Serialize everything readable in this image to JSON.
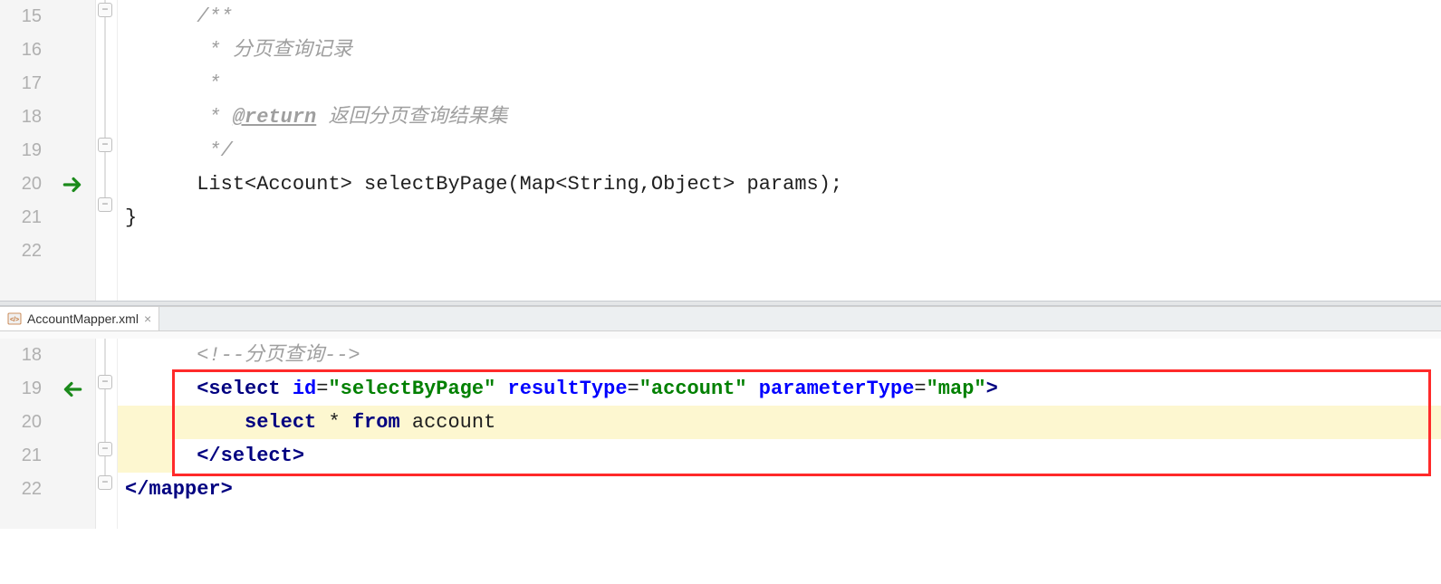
{
  "pane1": {
    "lines": [
      "15",
      "16",
      "17",
      "18",
      "19",
      "20",
      "21",
      "22"
    ],
    "comment_open": "/**",
    "comment_l1": " * 分页查询记录",
    "comment_l2": " *",
    "comment_return_tag": "@return",
    "comment_return_text": " 返回分页查询结果集",
    "comment_close": " */",
    "method_sig": "List<Account> selectByPage(Map<String,Object> params);",
    "brace_close": "}"
  },
  "tab": {
    "filename": "AccountMapper.xml",
    "close_glyph": "×"
  },
  "pane2": {
    "lines": [
      "18",
      "19",
      "20",
      "21",
      "22"
    ],
    "xml_comment": "<!--分页查询-->",
    "tag_open_lt": "<",
    "tag_select": "select",
    "attr_id": "id",
    "val_id": "\"selectByPage\"",
    "attr_rt": "resultType",
    "val_rt": "\"account\"",
    "attr_pt": "parameterType",
    "val_pt": "\"map\"",
    "tag_open_gt": ">",
    "sql_select": "select",
    "sql_star": " * ",
    "sql_from": "from",
    "sql_table": " account",
    "tag_close_select": "</",
    "tag_close_select_name": "select",
    "tag_close_gt": ">",
    "tag_close_mapper": "</",
    "tag_close_mapper_name": "mapper",
    "eq": "="
  }
}
